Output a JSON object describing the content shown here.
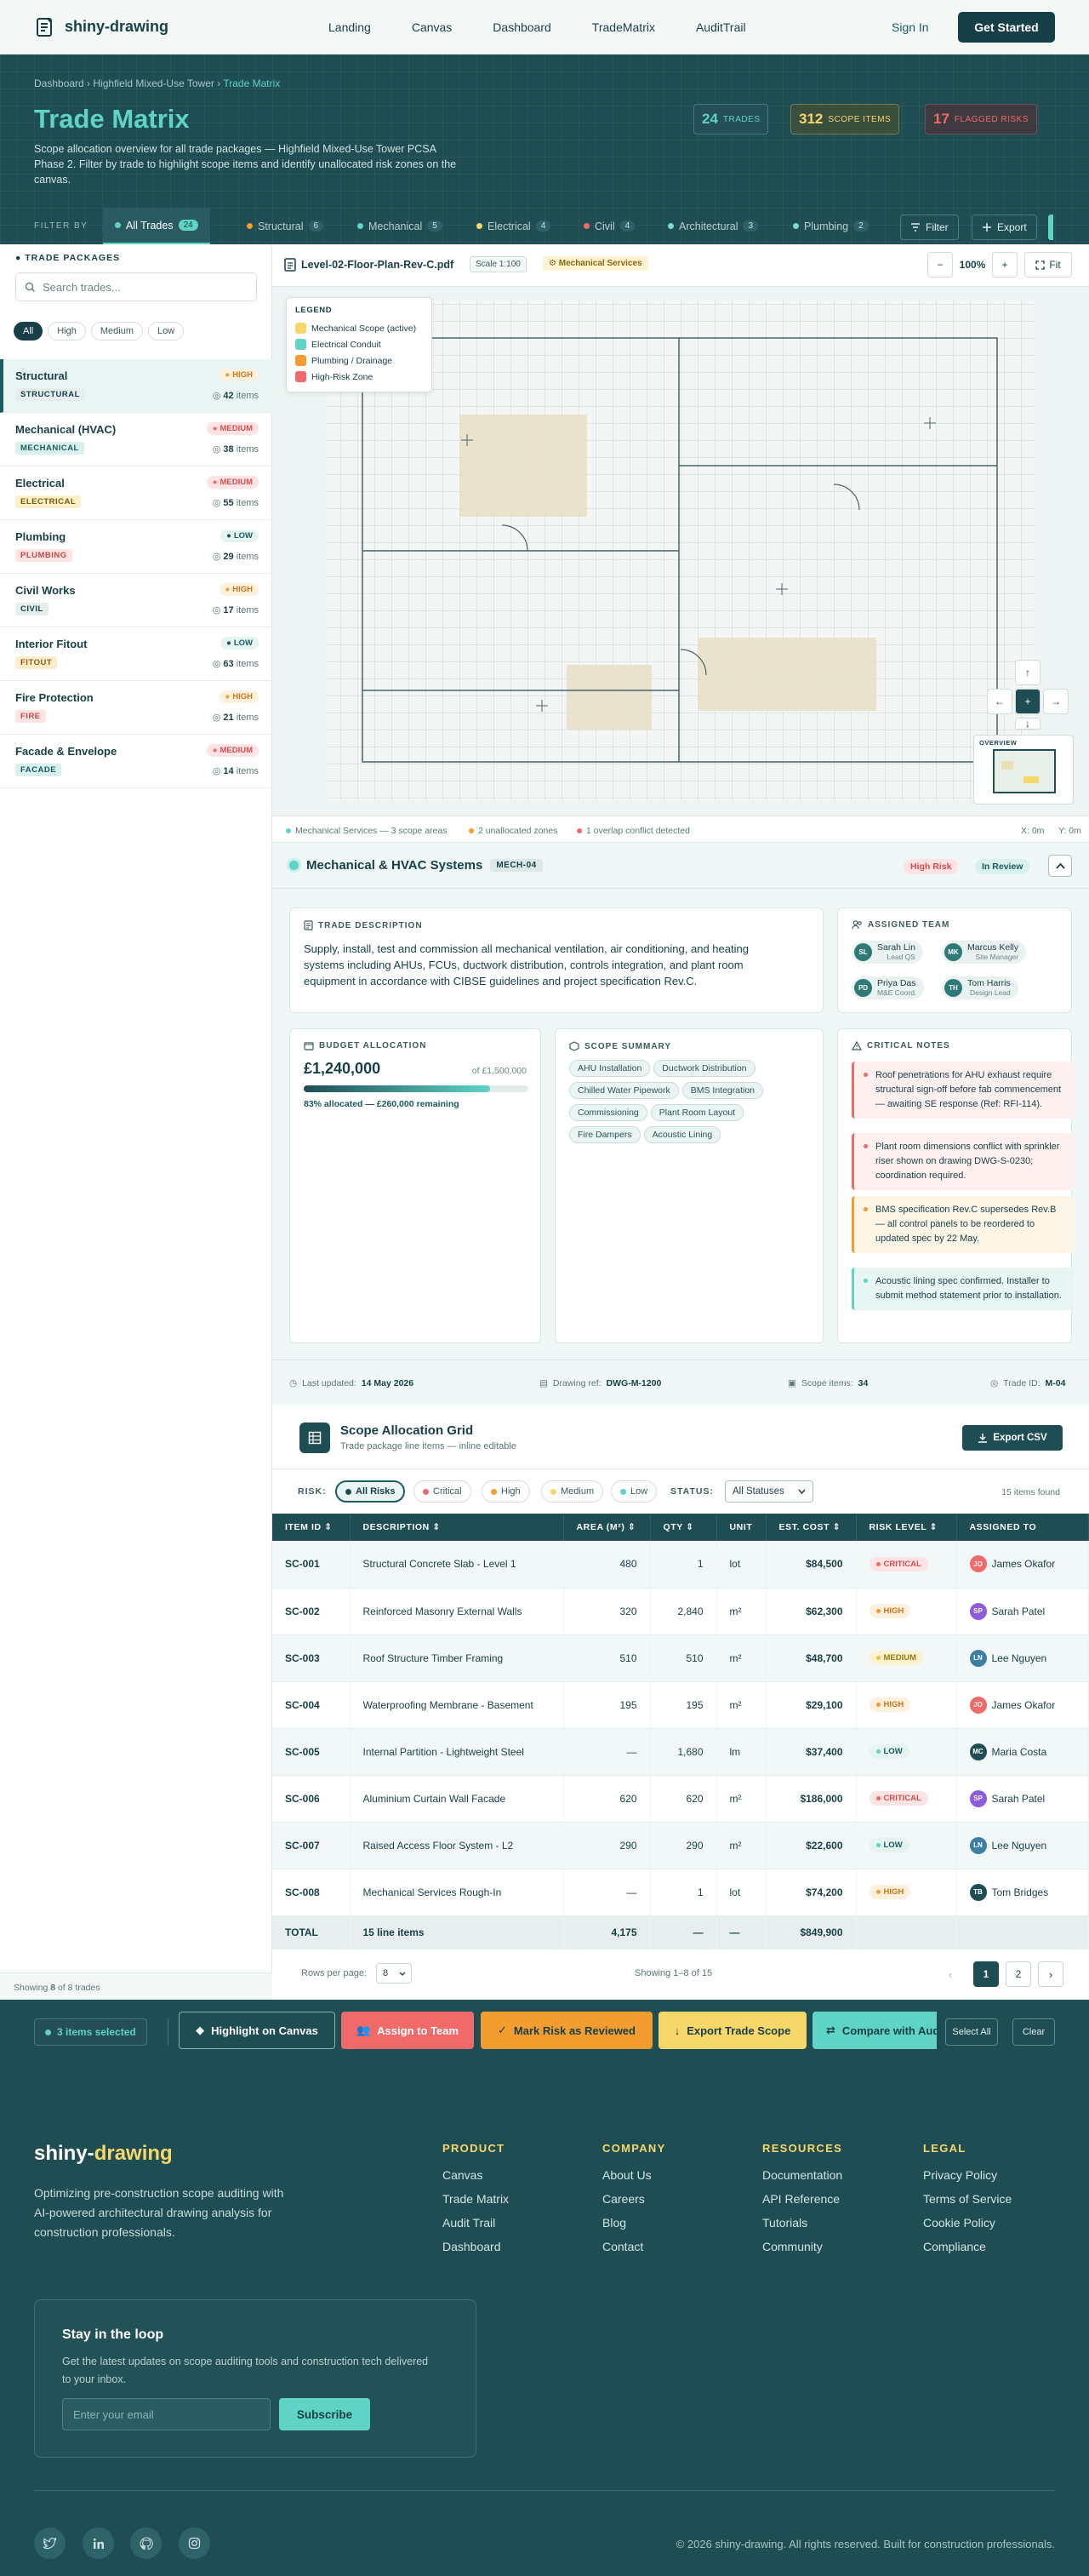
{
  "nav": {
    "brand": "shiny-drawing",
    "links": [
      "Landing",
      "Canvas",
      "Dashboard",
      "TradeMatrix",
      "AuditTrail"
    ],
    "sign_in": "Sign In",
    "get_started": "Get Started"
  },
  "hero": {
    "breadcrumb": [
      "Dashboard",
      "Highfield Mixed-Use Tower",
      "Trade Matrix"
    ],
    "title": "Trade Matrix",
    "description": "Scope allocation overview for all trade packages — Highfield Mixed-Use Tower PCSA Phase 2. Filter by trade to highlight scope items and identify unallocated risk zones on the canvas.",
    "stats": [
      {
        "value": "24",
        "label": "TRADES",
        "color": "#5fd3c6"
      },
      {
        "value": "312",
        "label": "SCOPE ITEMS",
        "color": "#f7d76a"
      },
      {
        "value": "17",
        "label": "FLAGGED RISKS",
        "color": "#f06a6a"
      }
    ]
  },
  "filter_bar": {
    "label": "FILTER BY",
    "tabs": [
      {
        "label": "All Trades",
        "count": "24",
        "color": "#5fd3c6"
      },
      {
        "label": "Structural",
        "count": "6",
        "color": "#f39c30"
      },
      {
        "label": "Mechanical",
        "count": "5",
        "color": "#5fd3c6"
      },
      {
        "label": "Electrical",
        "count": "4",
        "color": "#f7d76a"
      },
      {
        "label": "Civil",
        "count": "4",
        "color": "#f06a6a"
      },
      {
        "label": "Architectural",
        "count": "3",
        "color": "#7fd9d0"
      },
      {
        "label": "Plumbing",
        "count": "2",
        "color": "#7fd9d0"
      }
    ],
    "filter_btn": "Filter",
    "export_btn": "Export"
  },
  "sidebar": {
    "heading": "TRADE PACKAGES",
    "search_placeholder": "Search trades...",
    "chips": [
      "All",
      "High",
      "Medium",
      "Low"
    ],
    "packages": [
      {
        "name": "Structural",
        "tag": "STRUCTURAL",
        "risk": "HIGH",
        "items": "42"
      },
      {
        "name": "Mechanical (HVAC)",
        "tag": "MECHANICAL",
        "risk": "MEDIUM",
        "items": "38"
      },
      {
        "name": "Electrical",
        "tag": "ELECTRICAL",
        "risk": "MEDIUM",
        "items": "55"
      },
      {
        "name": "Plumbing",
        "tag": "PLUMBING",
        "risk": "LOW",
        "items": "29"
      },
      {
        "name": "Civil Works",
        "tag": "CIVIL",
        "risk": "HIGH",
        "items": "17"
      },
      {
        "name": "Interior Fitout",
        "tag": "FITOUT",
        "risk": "LOW",
        "items": "63"
      },
      {
        "name": "Fire Protection",
        "tag": "FIRE",
        "risk": "HIGH",
        "items": "21"
      },
      {
        "name": "Facade & Envelope",
        "tag": "FACADE",
        "risk": "MEDIUM",
        "items": "14"
      }
    ],
    "items_word": "items",
    "footer_pre": "Showing ",
    "footer_shown": "8",
    "footer_mid": " of ",
    "footer_total": "8",
    "footer_post": " trades"
  },
  "canvas": {
    "filename": "Level-02-Floor-Plan-Rev-C.pdf",
    "scale": "Scale 1:100",
    "service": "Mechanical Services",
    "zoom": "100%",
    "fit": "Fit",
    "legend_title": "LEGEND",
    "legend": [
      {
        "label": "Mechanical Scope (active)",
        "color": "#f7d76a"
      },
      {
        "label": "Electrical Conduit",
        "color": "#5fd3c6"
      },
      {
        "label": "Plumbing / Drainage",
        "color": "#f39c30"
      },
      {
        "label": "High-Risk Zone",
        "color": "#f06a6a"
      }
    ],
    "overview_label": "OVERVIEW",
    "status": [
      {
        "text": "Mechanical Services — 3 scope areas",
        "color": "#5fd3c6"
      },
      {
        "text": "2 unallocated zones",
        "color": "#f39c30"
      },
      {
        "text": "1 overlap conflict detected",
        "color": "#f06a6a"
      }
    ],
    "coords_x": "X: 0m",
    "coords_y": "Y: 0m"
  },
  "detail": {
    "title": "Mechanical & HVAC Systems",
    "code": "MECH-04",
    "risk": "High Risk",
    "status": "In Review",
    "description_heading": "TRADE DESCRIPTION",
    "description": "Supply, install, test and commission all mechanical ventilation, air conditioning, and heating systems including AHUs, FCUs, ductwork distribution, controls integration, and plant room equipment in accordance with CIBSE guidelines and project specification Rev.C.",
    "team_heading": "ASSIGNED TEAM",
    "team": [
      {
        "initials": "SL",
        "name": "Sarah Lin",
        "role": "Lead QS"
      },
      {
        "initials": "MK",
        "name": "Marcus Kelly",
        "role": "Site Manager"
      },
      {
        "initials": "PD",
        "name": "Priya Das",
        "role": "M&E Coord."
      },
      {
        "initials": "TH",
        "name": "Tom Harris",
        "role": "Design Lead"
      }
    ],
    "budget_heading": "BUDGET ALLOCATION",
    "budget_value": "£1,240,000",
    "budget_of": "of £1,500,000",
    "budget_pct": 83,
    "budget_note": "83% allocated — £260,000 remaining",
    "scope_heading": "SCOPE SUMMARY",
    "scope": [
      "AHU Installation",
      "Ductwork Distribution",
      "Chilled Water Pipework",
      "BMS Integration",
      "Commissioning",
      "Plant Room Layout",
      "Fire Dampers",
      "Acoustic Lining"
    ],
    "notes_heading": "CRITICAL NOTES",
    "notes": [
      {
        "text": "Roof penetrations for AHU exhaust require structural sign-off before fab commencement — awaiting SE response (Ref: RFI-114).",
        "color": "#f06a6a"
      },
      {
        "text": "Plant room dimensions conflict with sprinkler riser shown on drawing DWG-S-0230; coordination required.",
        "color": "#f06a6a"
      },
      {
        "text": "BMS specification Rev.C supersedes Rev.B — all control panels to be reordered to updated spec by 22 May.",
        "color": "#f39c30"
      },
      {
        "text": "Acoustic lining spec confirmed. Installer to submit method statement prior to installation.",
        "color": "#5fd3c6"
      }
    ],
    "footer": {
      "updated_label": "Last updated:",
      "updated": "14 May 2026",
      "drawing_label": "Drawing ref:",
      "drawing": "DWG-M-1200",
      "scope_label": "Scope items:",
      "scope": "34",
      "trade_label": "Trade ID:",
      "trade": "M-04"
    }
  },
  "grid": {
    "title": "Scope Allocation Grid",
    "subtitle": "Trade package line items — inline editable",
    "export": "Export CSV",
    "risk_label": "RISK:",
    "risk_chips": [
      {
        "label": "All Risks",
        "color": "#1f4d54"
      },
      {
        "label": "Critical",
        "color": "#f06a6a"
      },
      {
        "label": "High",
        "color": "#f39c30"
      },
      {
        "label": "Medium",
        "color": "#f7d76a"
      },
      {
        "label": "Low",
        "color": "#5fd3c6"
      }
    ],
    "status_label": "STATUS:",
    "status_value": "All Statuses",
    "found": "15 items found",
    "columns": [
      "ITEM ID",
      "DESCRIPTION",
      "AREA (M²)",
      "QTY",
      "UNIT",
      "EST. COST",
      "RISK LEVEL",
      "ASSIGNED TO"
    ],
    "rows": [
      {
        "id": "SC-001",
        "desc": "Structural Concrete Slab - Level 1",
        "area": "480",
        "qty": "1",
        "unit": "lot",
        "cost": "$84,500",
        "risk": "CRITICAL",
        "initials": "JO",
        "who": "James Okafor",
        "avc": "#f06a6a"
      },
      {
        "id": "SC-002",
        "desc": "Reinforced Masonry External Walls",
        "area": "320",
        "qty": "2,840",
        "unit": "m²",
        "cost": "$62,300",
        "risk": "HIGH",
        "initials": "SP",
        "who": "Sarah Patel",
        "avc": "#8e5be0"
      },
      {
        "id": "SC-003",
        "desc": "Roof Structure Timber Framing",
        "area": "510",
        "qty": "510",
        "unit": "m²",
        "cost": "$48,700",
        "risk": "MEDIUM",
        "initials": "LN",
        "who": "Lee Nguyen",
        "avc": "#3d7fa3"
      },
      {
        "id": "SC-004",
        "desc": "Waterproofing Membrane - Basement",
        "area": "195",
        "qty": "195",
        "unit": "m²",
        "cost": "$29,100",
        "risk": "HIGH",
        "initials": "JO",
        "who": "James Okafor",
        "avc": "#f06a6a"
      },
      {
        "id": "SC-005",
        "desc": "Internal Partition - Lightweight Steel",
        "area": "—",
        "qty": "1,680",
        "unit": "lm",
        "cost": "$37,400",
        "risk": "LOW",
        "initials": "MC",
        "who": "Maria Costa",
        "avc": "#1f4d54"
      },
      {
        "id": "SC-006",
        "desc": "Aluminium Curtain Wall Facade",
        "area": "620",
        "qty": "620",
        "unit": "m²",
        "cost": "$186,000",
        "risk": "CRITICAL",
        "initials": "SP",
        "who": "Sarah Patel",
        "avc": "#8e5be0"
      },
      {
        "id": "SC-007",
        "desc": "Raised Access Floor System - L2",
        "area": "290",
        "qty": "290",
        "unit": "m²",
        "cost": "$22,600",
        "risk": "LOW",
        "initials": "LN",
        "who": "Lee Nguyen",
        "avc": "#3d7fa3"
      },
      {
        "id": "SC-008",
        "desc": "Mechanical Services Rough-In",
        "area": "—",
        "qty": "1",
        "unit": "lot",
        "cost": "$74,200",
        "risk": "HIGH",
        "initials": "TB",
        "who": "Tom Bridges",
        "avc": "#1f4d54"
      }
    ],
    "total": {
      "label": "TOTAL",
      "items": "15 line items",
      "area": "4,175",
      "qty": "—",
      "unit": "—",
      "cost": "$849,900"
    },
    "rows_per_page_label": "Rows per page:",
    "rows_per_page": "8",
    "showing": "Showing 1–8 of 15",
    "pages": [
      "1",
      "2"
    ]
  },
  "bulk": {
    "selected": "3 items selected",
    "actions": [
      "Highlight on Canvas",
      "Assign to Team",
      "Mark Risk as Reviewed",
      "Export Trade Scope",
      "Compare with Audit"
    ],
    "select_all": "Select All",
    "clear": "Clear"
  },
  "footer": {
    "brand_a": "shiny-",
    "brand_b": "drawing",
    "description": "Optimizing pre-construction scope auditing with AI-powered architectural drawing analysis for construction professionals.",
    "columns": [
      {
        "title": "PRODUCT",
        "links": [
          "Canvas",
          "Trade Matrix",
          "Audit Trail",
          "Dashboard"
        ]
      },
      {
        "title": "COMPANY",
        "links": [
          "About Us",
          "Careers",
          "Blog",
          "Contact"
        ]
      },
      {
        "title": "RESOURCES",
        "links": [
          "Documentation",
          "API Reference",
          "Tutorials",
          "Community"
        ]
      },
      {
        "title": "LEGAL",
        "links": [
          "Privacy Policy",
          "Terms of Service",
          "Cookie Policy",
          "Compliance"
        ]
      }
    ],
    "newsletter_title": "Stay in the loop",
    "newsletter_text": "Get the latest updates on scope auditing tools and construction tech delivered to your inbox.",
    "email_placeholder": "Enter your email",
    "subscribe": "Subscribe",
    "social": [
      "twitter-icon",
      "linkedin-icon",
      "github-icon",
      "instagram-icon"
    ],
    "copyright": "© 2026 shiny-drawing. All rights reserved. Built for construction professionals."
  }
}
